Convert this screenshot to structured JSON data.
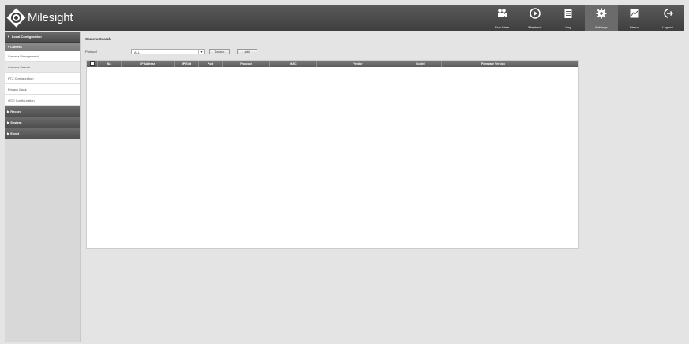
{
  "app": {
    "brand": "Milesight"
  },
  "nav": [
    {
      "label": "Live View",
      "icon": "camera-icon"
    },
    {
      "label": "Playback",
      "icon": "play-icon"
    },
    {
      "label": "Log",
      "icon": "log-icon"
    },
    {
      "label": "Settings",
      "icon": "gear-icon"
    },
    {
      "label": "Status",
      "icon": "status-icon"
    },
    {
      "label": "Logout",
      "icon": "logout-icon"
    }
  ],
  "sidebar": {
    "section": "Local Configuration",
    "subsection": "Camera",
    "items": [
      "Camera Management",
      "Camera Search",
      "PTZ Configuration",
      "Privacy Mask",
      "OSD Configuration"
    ],
    "groups": [
      "Record",
      "System",
      "Event"
    ]
  },
  "page": {
    "title": "Camera Search",
    "protocol_label": "Protocol",
    "protocol_value": "ALL",
    "search_button": "Search",
    "add_button": "Add"
  },
  "table": {
    "columns": [
      "No.",
      "IP Address",
      "IP Edit",
      "Port",
      "Protocol",
      "MAC",
      "Vendor",
      "Model",
      "Firmware Version"
    ]
  },
  "colors": {
    "header_bg": "#4a4a4a",
    "active_nav": "#6b6b6b",
    "table_header": "#6a6a6a"
  }
}
